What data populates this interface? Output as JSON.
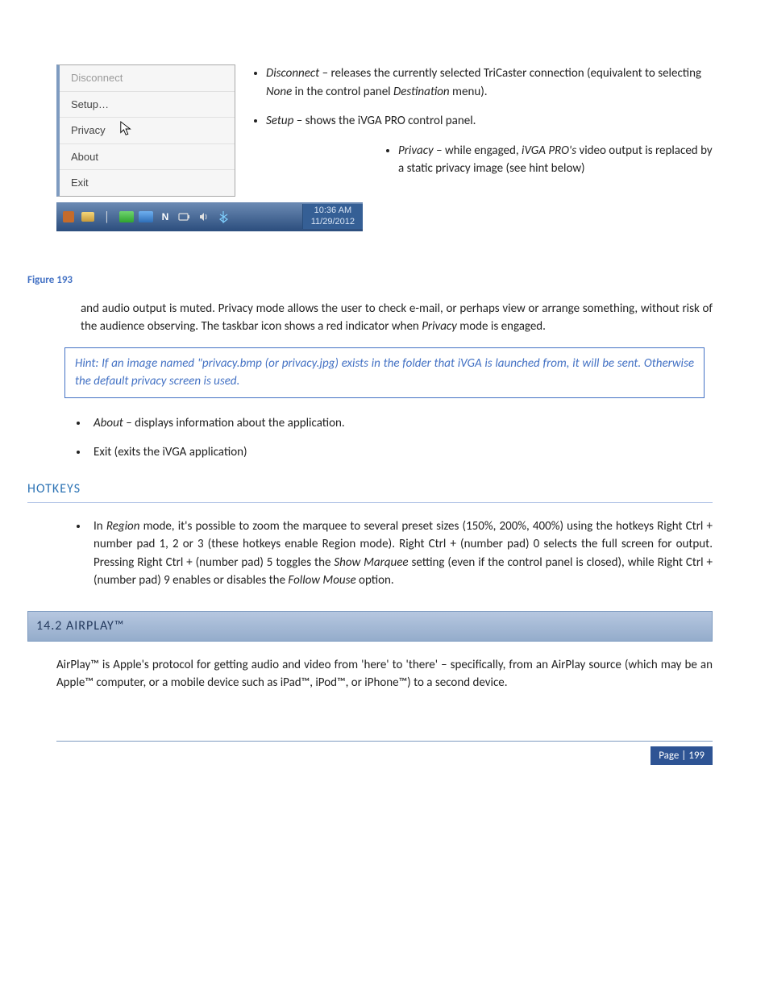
{
  "menu": {
    "disconnect": "Disconnect",
    "setup": "Setup…",
    "privacy": "Privacy",
    "about": "About",
    "exit": "Exit"
  },
  "taskbar": {
    "time": "10:36 AM",
    "date": "11/29/2012"
  },
  "figureCaption": "Figure 193",
  "bullets": {
    "disconnect_label": "Disconnect",
    "disconnect_text": " – releases the currently selected TriCaster connection (equivalent to selecting ",
    "disconnect_none": "None",
    "disconnect_tail": " in the control panel ",
    "disconnect_dest": "Destination",
    "disconnect_end": " menu).",
    "setup_label": "Setup",
    "setup_text": " – shows the iVGA PRO control panel.",
    "privacy_label": "Privacy",
    "privacy_text1": " – while engaged, ",
    "privacy_app": "iVGA PRO's",
    "privacy_text2": " video output is replaced by a static privacy image (see hint below)"
  },
  "para_after_privacy_1": "and audio output is muted.  Privacy mode allows the user to check e-mail, or perhaps view or arrange something, without risk of the audience observing.  The taskbar icon shows a red indicator when ",
  "para_after_privacy_em": "Privacy",
  "para_after_privacy_2": " mode is engaged.",
  "hint": "Hint: If an image named \"privacy.bmp (or privacy.jpg) exists in the folder that iVGA is launched from, it will be sent. Otherwise the default privacy screen is used.",
  "about_label": "About",
  "about_text": " – displays information about the application.",
  "exit_text": "Exit (exits the iVGA application)",
  "hotkeys_heading": "HOTKEYS",
  "hotkeys_pre": "In ",
  "hotkeys_region": "Region",
  "hotkeys_mid1": " mode, it's possible to zoom the marquee to several preset sizes (150%, 200%, 400%) using the hotkeys Right Ctrl + number pad 1, 2 or 3 (these hotkeys enable Region mode).  Right Ctrl + (number pad) 0 selects the full screen for output.  Pressing Right Ctrl + (number pad) 5 toggles the ",
  "hotkeys_showmarquee": "Show Marquee",
  "hotkeys_mid2": " setting (even if the control panel is closed), while Right Ctrl + (number pad) 9 enables or disables the ",
  "hotkeys_follow": "Follow Mouse",
  "hotkeys_tail": " option.",
  "airplay_heading": "14.2  AIRPLAY™",
  "airplay_para": "AirPlay™ is Apple's protocol for getting audio and video from 'here' to 'there' – specifically, from an AirPlay source (which may be an Apple™ computer, or a mobile device such as iPad™, iPod™, or iPhone™) to a second device.",
  "page_label": "Page | 199"
}
